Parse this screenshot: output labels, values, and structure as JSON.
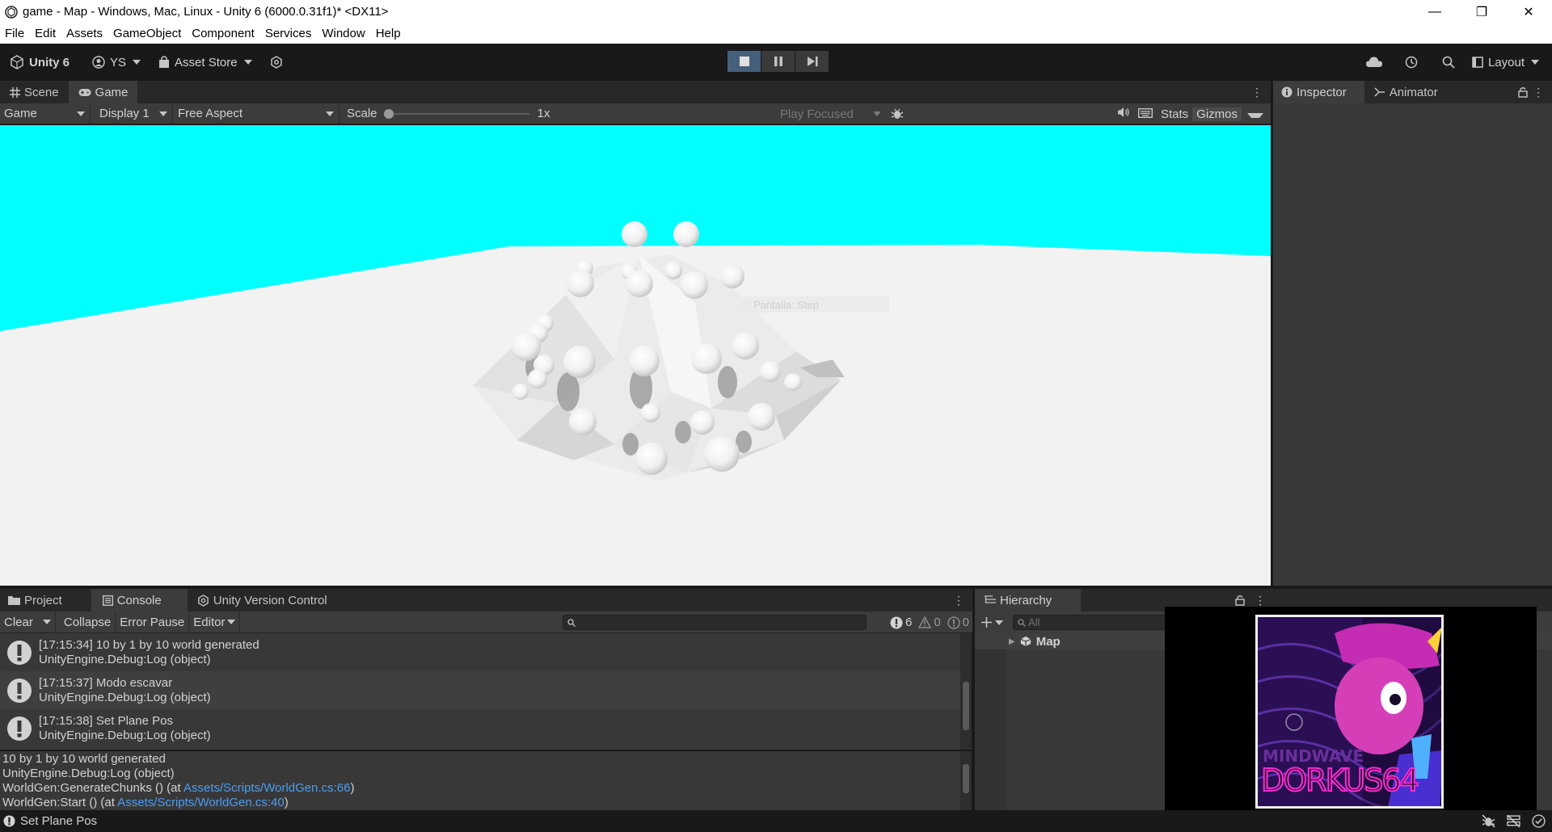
{
  "window": {
    "title": "game - Map - Windows, Mac, Linux - Unity 6 (6000.0.31f1)* <DX11>",
    "controls": [
      "—",
      "❐",
      "✕"
    ]
  },
  "menu": [
    "File",
    "Edit",
    "Assets",
    "GameObject",
    "Component",
    "Services",
    "Window",
    "Help"
  ],
  "toolbar": {
    "unity_label": "Unity 6",
    "account_label": "YS",
    "asset_store_label": "Asset Store",
    "layout_label": "Layout"
  },
  "game_panel": {
    "tabs": [
      "Scene",
      "Game"
    ],
    "active_tab": "Game",
    "view_mode": "Game",
    "display": "Display 1",
    "aspect": "Free Aspect",
    "scale_label": "Scale",
    "scale_value": "1x",
    "play_mode": "Play Focused",
    "stats_label": "Stats",
    "gizmos_label": "Gizmos",
    "sky_color": "#00ffff",
    "ground_color": "#f2f2f2",
    "overlay_text": "Pantalla: Step"
  },
  "inspector": {
    "tabs": [
      "Inspector",
      "Animator"
    ]
  },
  "console": {
    "tabs": [
      "Project",
      "Console",
      "Unity Version Control"
    ],
    "active_tab": "Console",
    "buttons": {
      "clear": "Clear",
      "collapse": "Collapse",
      "error_pause": "Error Pause",
      "editor": "Editor"
    },
    "counts": {
      "info": "6",
      "warnings": "0",
      "errors": "0"
    },
    "entries": [
      {
        "line1": "[17:15:34] 10 by 1 by 10 world generated",
        "line2": "UnityEngine.Debug:Log (object)"
      },
      {
        "line1": "[17:15:37] Modo escavar",
        "line2": "UnityEngine.Debug:Log (object)"
      },
      {
        "line1": "[17:15:38] Set Plane Pos",
        "line2": "UnityEngine.Debug:Log (object)"
      }
    ],
    "detail": {
      "line1": "10 by 1 by 10 world generated",
      "line2": "UnityEngine.Debug:Log (object)",
      "line3_prefix": "WorldGen:GenerateChunks () (at ",
      "line3_link": "Assets/Scripts/WorldGen.cs:66",
      "line3_suffix": ")",
      "line4_prefix": "WorldGen:Start () (at ",
      "line4_link": "Assets/Scripts/WorldGen.cs:40",
      "line4_suffix": ")"
    }
  },
  "hierarchy": {
    "tab": "Hierarchy",
    "search_placeholder": "All",
    "root": "Map"
  },
  "status": {
    "message": "Set Plane Pos"
  },
  "album": {
    "title_top": "MINDWAVE",
    "title_bottom": "DORKUS64"
  }
}
